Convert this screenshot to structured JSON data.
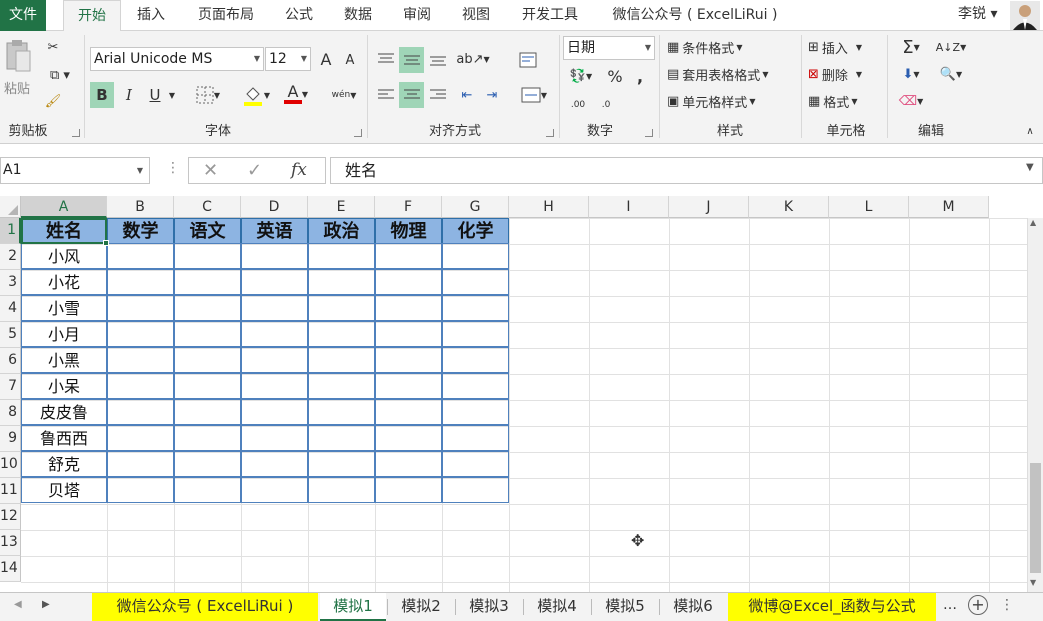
{
  "ribbon_tabs": [
    "文件",
    "开始",
    "插入",
    "页面布局",
    "公式",
    "数据",
    "审阅",
    "视图",
    "开发工具",
    "微信公众号 ( ExcelLiRui )"
  ],
  "user": "李锐 ▾",
  "clipboard": {
    "paste": "粘贴",
    "label": "剪贴板"
  },
  "font": {
    "name": "Arial Unicode MS",
    "size": "12",
    "label": "字体",
    "grow": "A",
    "shrink": "A",
    "bold": "B",
    "italic": "I",
    "underline": "U",
    "fontcolor": "A",
    "phonetic": "wén"
  },
  "alignment": {
    "label": "对齐方式"
  },
  "number": {
    "format": "日期",
    "label": "数字",
    "percent": "%",
    "comma": ",",
    "inc": ".00",
    "dec": ".0"
  },
  "styles": {
    "cond": "条件格式",
    "table": "套用表格格式",
    "cell": "单元格样式",
    "label": "样式"
  },
  "cells": {
    "insert": "插入",
    "delete": "删除",
    "format": "格式",
    "label": "单元格"
  },
  "editing": {
    "label": "编辑",
    "sum": "Σ"
  },
  "namebox": "A1",
  "formula": "姓名",
  "columns": [
    "A",
    "B",
    "C",
    "D",
    "E",
    "F",
    "G",
    "H",
    "I",
    "J",
    "K",
    "L",
    "M"
  ],
  "rows": [
    "1",
    "2",
    "3",
    "4",
    "5",
    "6",
    "7",
    "8",
    "9",
    "10",
    "11",
    "12",
    "13",
    "14"
  ],
  "table_headers": [
    "姓名",
    "数学",
    "语文",
    "英语",
    "政治",
    "物理",
    "化学"
  ],
  "names": [
    "小风",
    "小花",
    "小雪",
    "小月",
    "小黑",
    "小呆",
    "皮皮鲁",
    "鲁西西",
    "舒克",
    "贝塔"
  ],
  "sheets": [
    "微信公众号 ( ExcelLiRui )",
    "模拟1",
    "模拟2",
    "模拟3",
    "模拟4",
    "模拟5",
    "模拟6",
    "微博@Excel_函数与公式"
  ],
  "colors": {
    "accent": "#217346",
    "header_fill": "#8db4e2",
    "highlight": "#ffff00"
  }
}
